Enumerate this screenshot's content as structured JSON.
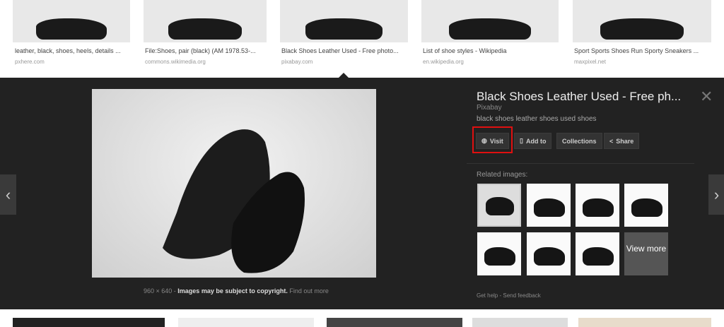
{
  "results": [
    {
      "title": "leather, black, shoes, heels, details ...",
      "source": "pxhere.com"
    },
    {
      "title": "File:Shoes, pair (black) (AM 1978.53-...",
      "source": "commons.wikimedia.org"
    },
    {
      "title": "Black Shoes Leather Used - Free photo...",
      "source": "pixabay.com"
    },
    {
      "title": "List of shoe styles - Wikipedia",
      "source": "en.wikipedia.org"
    },
    {
      "title": "Sport Sports Shoes Run Sporty Sneakers ...",
      "source": "maxpixel.net"
    }
  ],
  "detail": {
    "title": "Black Shoes Leather Used - Free ph...",
    "site": "Pixabay",
    "description": "black shoes leather shoes used shoes",
    "buttons": {
      "visit": "Visit",
      "add_to": "Add to",
      "collections": "Collections",
      "share": "Share"
    },
    "related_label": "Related images:",
    "view_more": "View more",
    "dimensions": "960 × 640",
    "copyright": "Images may be subject to copyright.",
    "find_out_more": "Find out more",
    "get_help": "Get help",
    "send_feedback": "Send feedback",
    "highlight_color": "#e01010"
  }
}
